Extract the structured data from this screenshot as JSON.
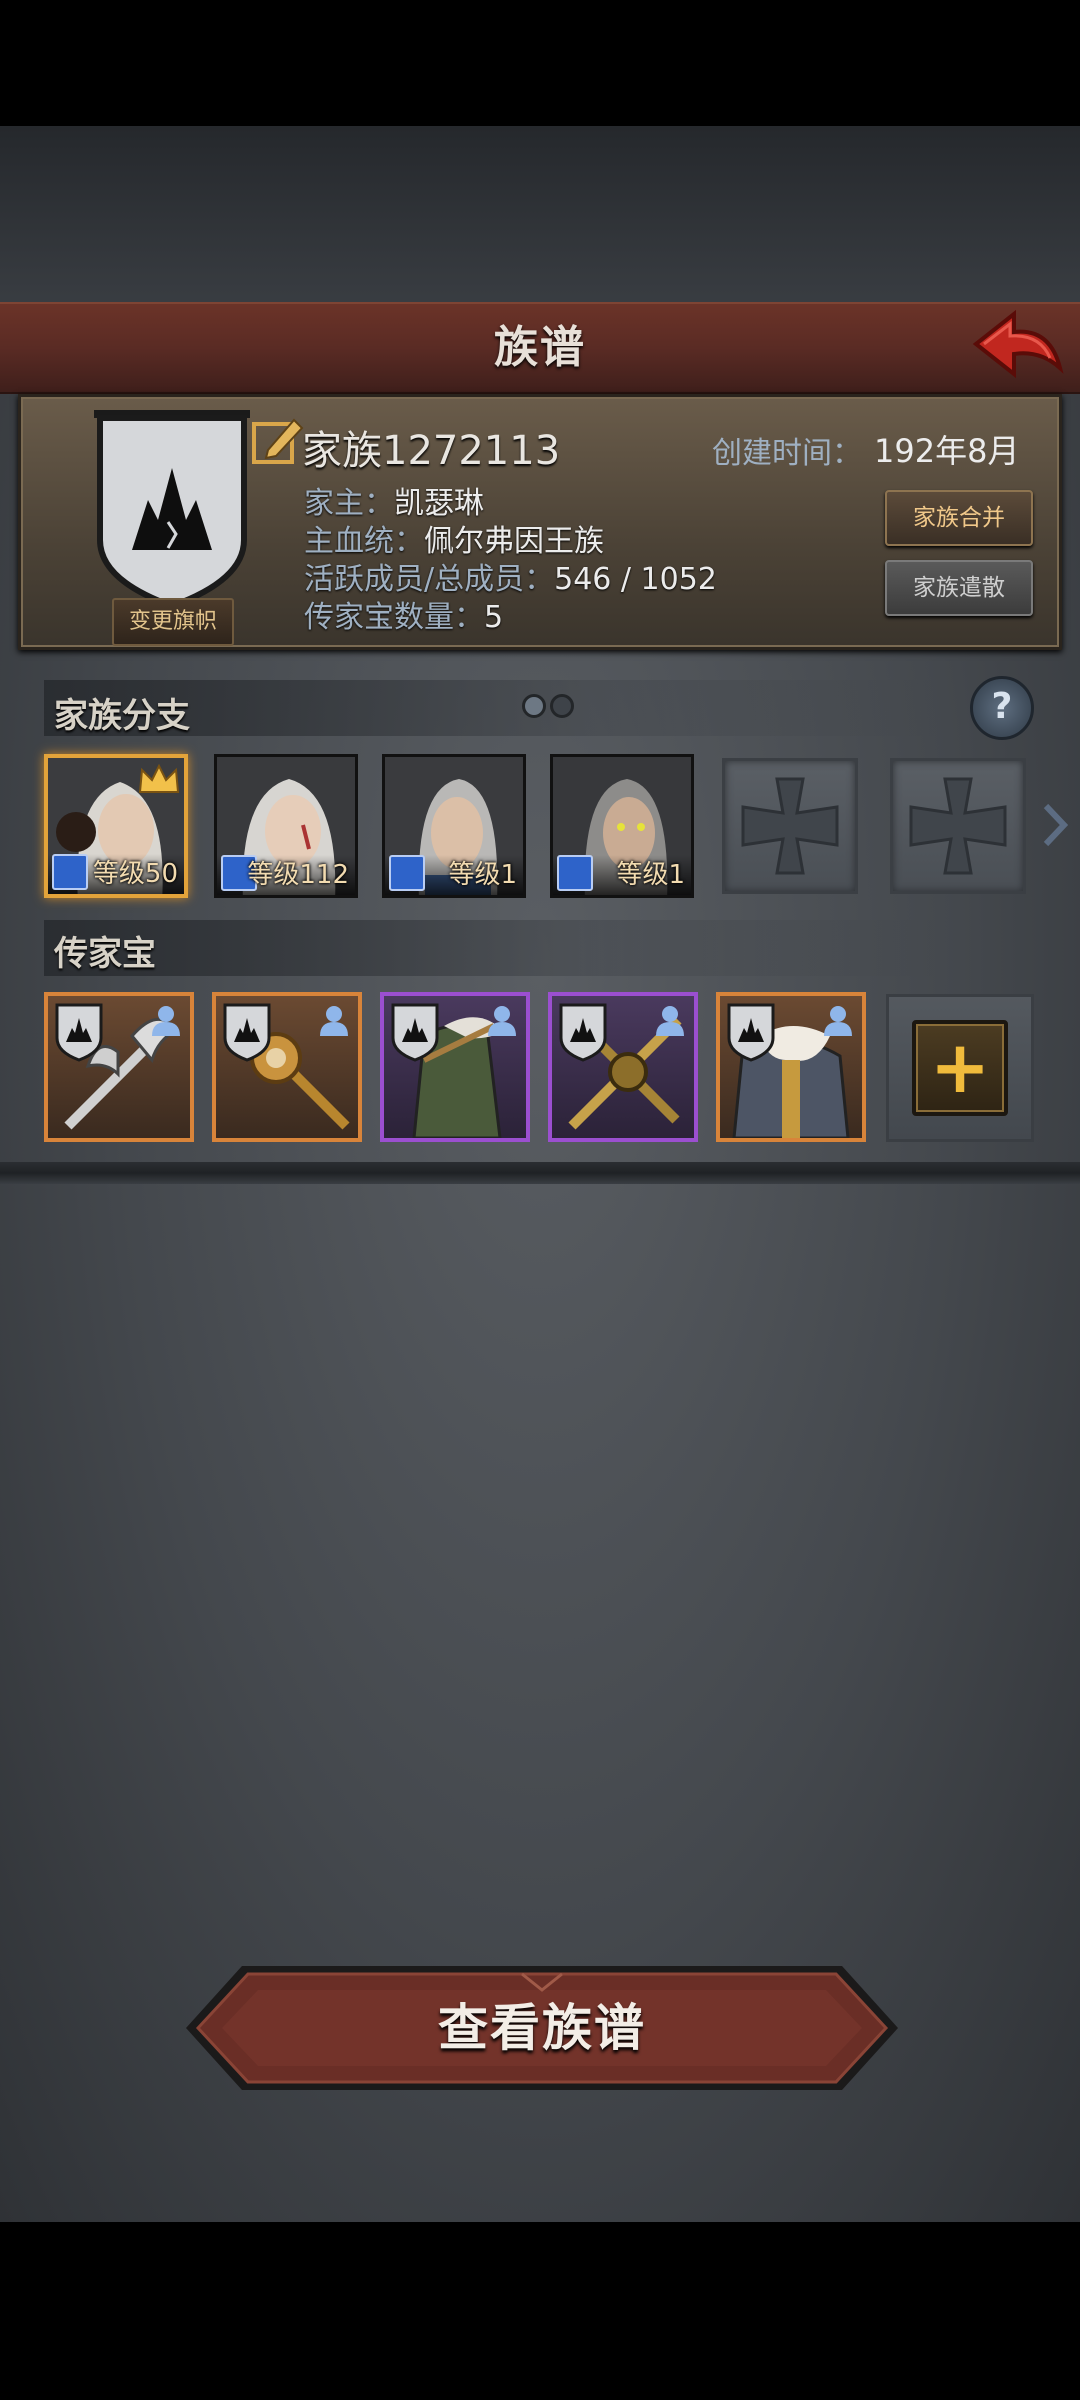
{
  "header": {
    "title": "族谱"
  },
  "family": {
    "name": "家族1272113",
    "created_label": "创建时间：",
    "created_value": "192年8月",
    "leader_label": "家主：",
    "leader_value": "凯瑟琳",
    "bloodline_label": "主血统：",
    "bloodline_value": "佩尔弗因王族",
    "members_label": "活跃成员/总成员：",
    "members_value": "546 / 1052",
    "heirloom_count_label": "传家宝数量：",
    "heirloom_count_value": "5",
    "change_banner_label": "变更旗帜",
    "merge_label": "家族合并",
    "dismiss_label": "家族遣散"
  },
  "branches": {
    "title": "家族分支",
    "items": [
      {
        "level_text": "等级50",
        "leader": true
      },
      {
        "level_text": "等级112",
        "leader": false
      },
      {
        "level_text": "等级1",
        "leader": false
      },
      {
        "level_text": "等级1",
        "leader": false
      }
    ],
    "empty_slots": 2,
    "page_count": 2,
    "current_page": 1
  },
  "heirlooms": {
    "title": "传家宝",
    "items": [
      {
        "name": "halberd",
        "rarity": "orange"
      },
      {
        "name": "scepter",
        "rarity": "orange"
      },
      {
        "name": "cloak",
        "rarity": "purple"
      },
      {
        "name": "crossed-swords",
        "rarity": "purple"
      },
      {
        "name": "fur-coat",
        "rarity": "orange"
      }
    ]
  },
  "actions": {
    "view_tree_label": "查看族谱"
  },
  "colors": {
    "accent_gold": "#e3a33a",
    "rarity_orange": "#d8843a",
    "rarity_purple": "#9b4fd0",
    "title_red": "#5a2b24"
  }
}
